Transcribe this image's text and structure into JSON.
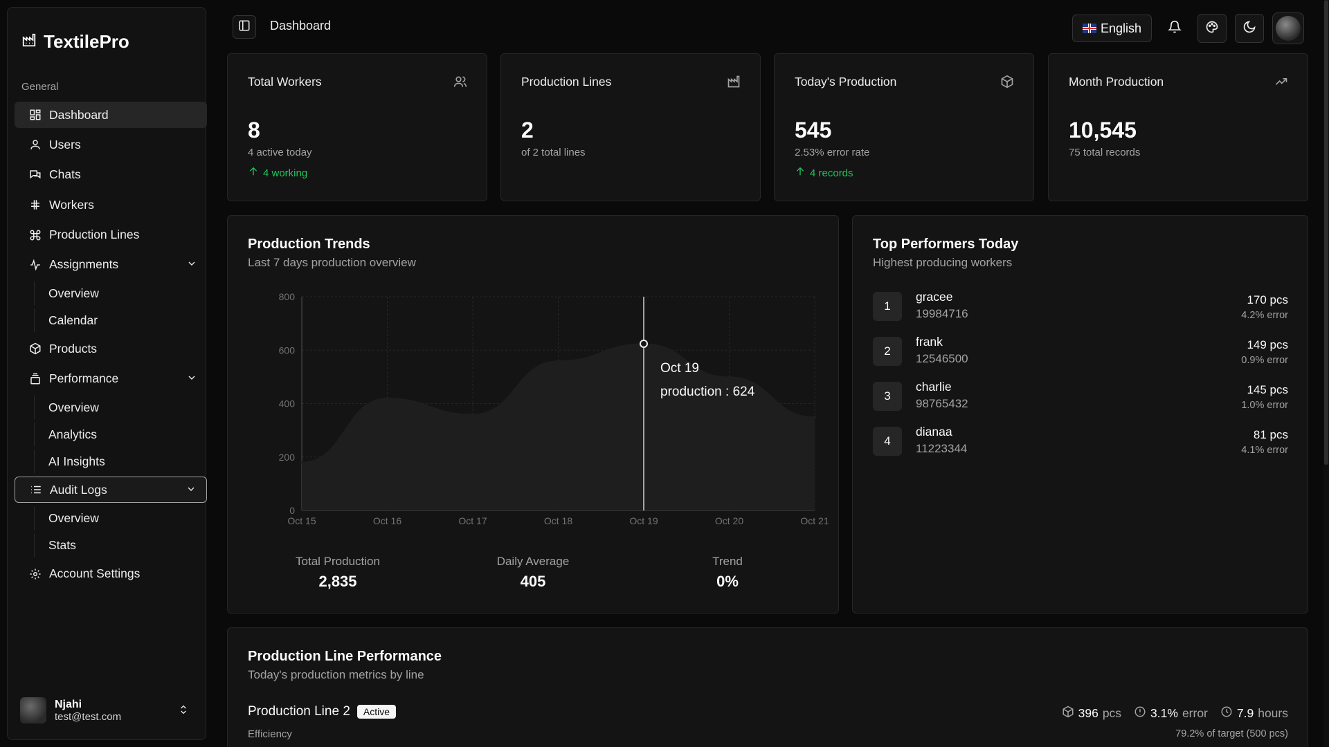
{
  "app": {
    "name": "TextilePro"
  },
  "sidebar": {
    "section": "General",
    "items": [
      {
        "label": "Dashboard",
        "icon": "dashboard-icon"
      },
      {
        "label": "Users",
        "icon": "user-icon"
      },
      {
        "label": "Chats",
        "icon": "chat-icon"
      },
      {
        "label": "Workers",
        "icon": "hash-icon"
      },
      {
        "label": "Production Lines",
        "icon": "command-icon"
      },
      {
        "label": "Assignments",
        "icon": "activity-icon",
        "sub": [
          "Overview",
          "Calendar"
        ]
      },
      {
        "label": "Products",
        "icon": "package-icon"
      },
      {
        "label": "Performance",
        "icon": "layers-icon",
        "sub": [
          "Overview",
          "Analytics",
          "AI Insights"
        ]
      },
      {
        "label": "Audit Logs",
        "icon": "list-icon",
        "sub": [
          "Overview",
          "Stats"
        ]
      },
      {
        "label": "Account Settings",
        "icon": "gear-icon"
      }
    ],
    "user": {
      "name": "Njahi",
      "email": "test@test.com"
    }
  },
  "header": {
    "title": "Dashboard",
    "language": "English"
  },
  "stats": [
    {
      "title": "Total Workers",
      "value": "8",
      "sub": "4 active today",
      "trend": "4 working",
      "icon": "users-icon"
    },
    {
      "title": "Production Lines",
      "value": "2",
      "sub": "of 2 total lines",
      "trend": "",
      "icon": "factory-icon"
    },
    {
      "title": "Today's Production",
      "value": "545",
      "sub": "2.53% error rate",
      "trend": "4 records",
      "icon": "box-icon"
    },
    {
      "title": "Month Production",
      "value": "10,545",
      "sub": "75 total records",
      "trend": "",
      "icon": "trending-up-icon"
    }
  ],
  "trends": {
    "title": "Production Trends",
    "subtitle": "Last 7 days production overview",
    "tooltip": {
      "date": "Oct 19",
      "text": "production : 624"
    },
    "summary": [
      {
        "label": "Total Production",
        "value": "2,835"
      },
      {
        "label": "Daily Average",
        "value": "405"
      },
      {
        "label": "Trend",
        "value": "0%"
      }
    ]
  },
  "chart_data": {
    "type": "area",
    "categories": [
      "Oct 15",
      "Oct 16",
      "Oct 17",
      "Oct 18",
      "Oct 19",
      "Oct 20",
      "Oct 21"
    ],
    "series": [
      {
        "name": "production",
        "values": [
          180,
          420,
          360,
          560,
          624,
          500,
          350
        ]
      }
    ],
    "ylim": [
      0,
      800
    ],
    "yticks": [
      0,
      200,
      400,
      600,
      800
    ],
    "grid": true,
    "highlight_index": 4
  },
  "performers": {
    "title": "Top Performers Today",
    "subtitle": "Highest producing workers",
    "rows": [
      {
        "rank": "1",
        "name": "gracee",
        "id": "19984716",
        "pcs": "170 pcs",
        "error": "4.2% error"
      },
      {
        "rank": "2",
        "name": "frank",
        "id": "12546500",
        "pcs": "149 pcs",
        "error": "0.9% error"
      },
      {
        "rank": "3",
        "name": "charlie",
        "id": "98765432",
        "pcs": "145 pcs",
        "error": "1.0% error"
      },
      {
        "rank": "4",
        "name": "dianaa",
        "id": "11223344",
        "pcs": "81 pcs",
        "error": "4.1% error"
      }
    ]
  },
  "line_performance": {
    "title": "Production Line Performance",
    "subtitle": "Today's production metrics by line",
    "line": {
      "name": "Production Line 2",
      "status": "Active",
      "pcs_value": "396",
      "pcs_unit": "pcs",
      "error_value": "3.1%",
      "error_unit": "error",
      "hours_value": "7.9",
      "hours_unit": "hours",
      "efficiency_label": "Efficiency",
      "target_text": "79.2% of target (500 pcs)"
    }
  },
  "colors": {
    "accent_green": "#22c55e",
    "background": "#0a0a0a",
    "card": "#141414"
  }
}
